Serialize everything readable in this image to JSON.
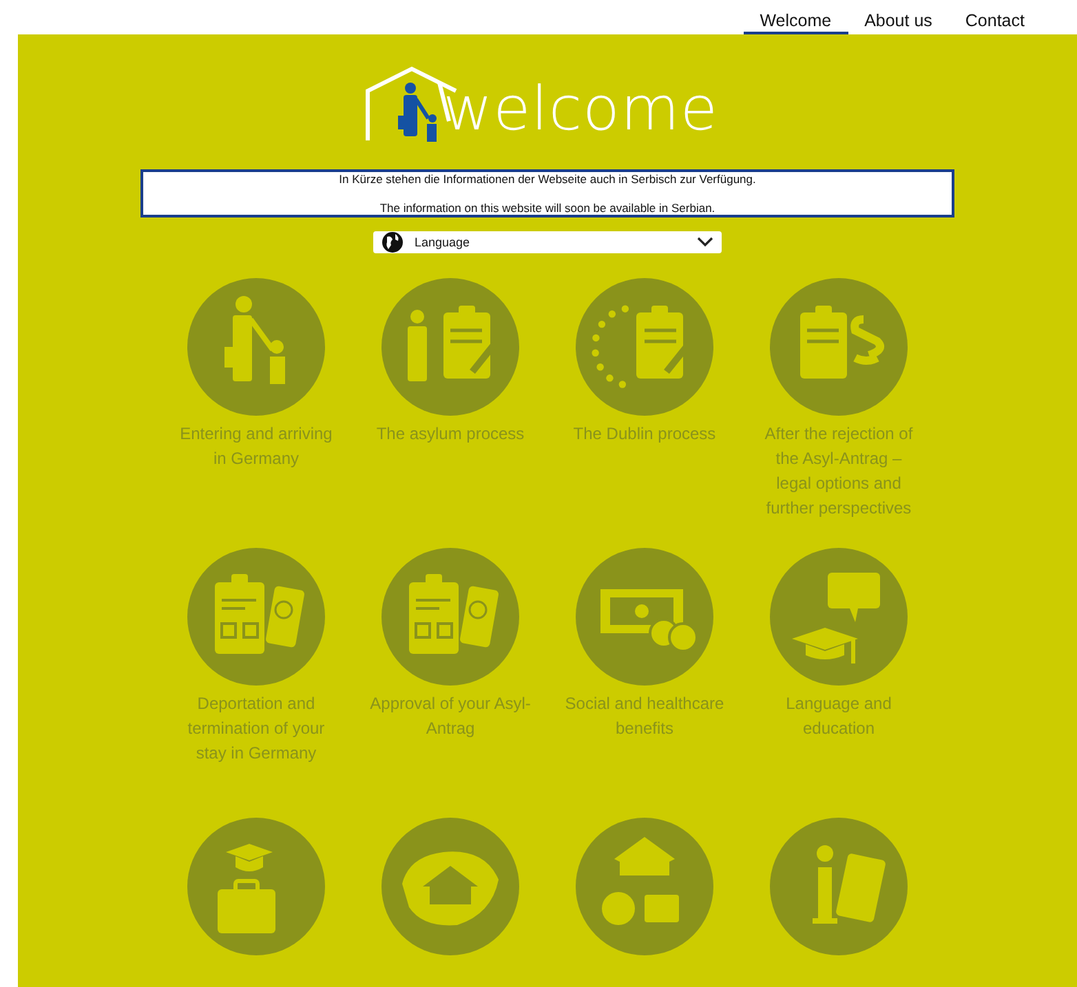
{
  "nav": [
    {
      "label": "Welcome",
      "selected": true
    },
    {
      "label": "About us",
      "selected": false
    },
    {
      "label": "Contact",
      "selected": false
    }
  ],
  "logo": {
    "text": "welcome"
  },
  "notice": {
    "lines": [
      "In Kürze stehen die Informationen der Webseite auch in Serbisch zur Verfügung.",
      "The information on this website will soon be available in Serbian."
    ]
  },
  "language_select": {
    "value": "Language"
  },
  "topics": [
    {
      "kind": "labeled",
      "label": "Entering and arriving in Germany"
    },
    {
      "kind": "labeled",
      "label": "The asylum process"
    },
    {
      "kind": "labeled",
      "label": "The Dublin process"
    },
    {
      "kind": "labeled",
      "label": "After the rejection of the Asyl-Antrag – legal options and further perspectives"
    },
    {
      "kind": "labeled",
      "label": "Deportation and termination of your stay in Germany"
    },
    {
      "kind": "labeled",
      "label": "Approval of your Asyl-Antrag"
    },
    {
      "kind": "labeled",
      "label": "Social and healthcare benefits"
    },
    {
      "kind": "labeled",
      "label": "Language and education"
    },
    {
      "kind": "icon_only"
    },
    {
      "kind": "icon_only"
    },
    {
      "kind": "icon_only"
    },
    {
      "kind": "icon_only"
    }
  ]
}
